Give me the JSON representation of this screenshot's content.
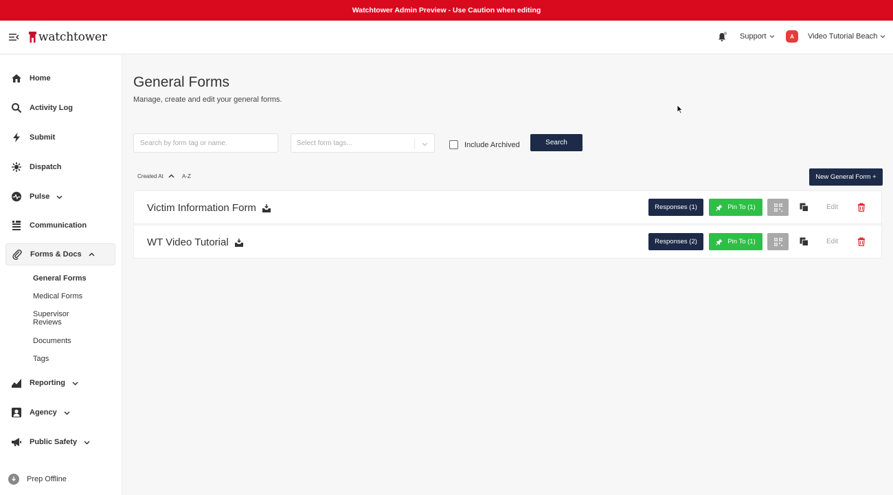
{
  "banner": {
    "text": "Watchtower Admin Preview - Use Caution when editing"
  },
  "header": {
    "logo_text": "watchtower",
    "support_label": "Support",
    "agency_badge": "A",
    "agency_name": "Video Tutorial Beach"
  },
  "sidebar": {
    "items": [
      {
        "label": "Home",
        "icon": "home-icon"
      },
      {
        "label": "Activity Log",
        "icon": "search-icon"
      },
      {
        "label": "Submit",
        "icon": "lightning-icon"
      },
      {
        "label": "Dispatch",
        "icon": "dispatch-icon"
      },
      {
        "label": "Pulse",
        "icon": "pulse-icon"
      },
      {
        "label": "Communication",
        "icon": "communication-icon"
      },
      {
        "label": "Forms & Docs",
        "icon": "paperclip-icon"
      },
      {
        "label": "Reporting",
        "icon": "reporting-icon"
      },
      {
        "label": "Agency",
        "icon": "agency-icon"
      },
      {
        "label": "Public Safety",
        "icon": "megaphone-icon"
      }
    ],
    "sub_items": [
      "General Forms",
      "Medical Forms",
      "Supervisor Reviews",
      "Documents",
      "Tags"
    ],
    "prep_offline": "Prep Offline"
  },
  "main": {
    "title": "General Forms",
    "subtitle": "Manage, create and edit your general forms.",
    "search_placeholder": "Search by form tag or name.",
    "tags_placeholder": "Select form tags...",
    "include_archived": "Include Archived",
    "search_button": "Search",
    "sort_created": "Created At",
    "sort_az": "A-Z",
    "new_button": "New General Form +",
    "forms": [
      {
        "name": "Victim Information Form",
        "responses": "Responses (1)",
        "pin": "Pin To (1)",
        "edit": "Edit"
      },
      {
        "name": "WT Video Tutorial",
        "responses": "Responses (2)",
        "pin": "Pin To (1)",
        "edit": "Edit"
      }
    ]
  },
  "colors": {
    "banner": "#d90a1d",
    "navy": "#1d2b48",
    "green": "#2ec046",
    "danger": "#e02424"
  }
}
